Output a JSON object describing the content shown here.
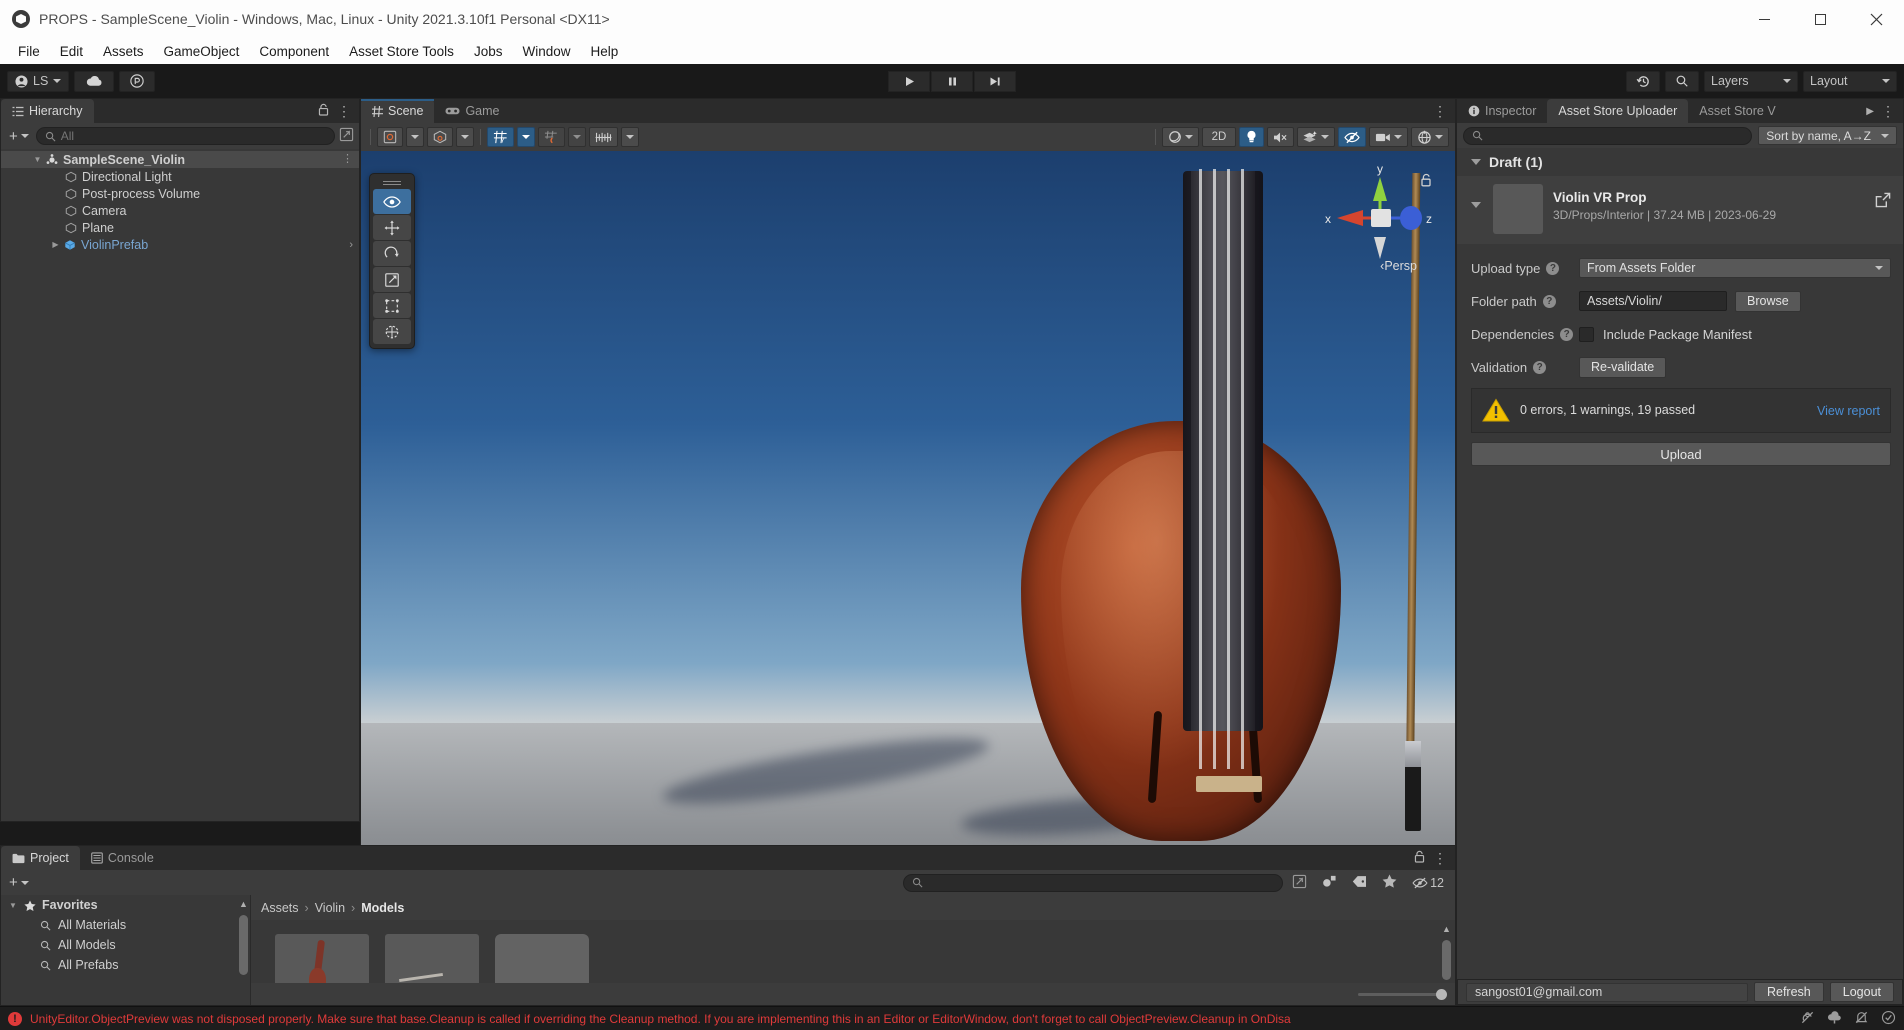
{
  "window": {
    "title": "PROPS - SampleScene_Violin - Windows, Mac, Linux - Unity 2021.3.10f1 Personal <DX11>",
    "minimize": "–",
    "maximize": "□",
    "close": "✕"
  },
  "menubar": {
    "items": [
      "File",
      "Edit",
      "Assets",
      "GameObject",
      "Component",
      "Asset Store Tools",
      "Jobs",
      "Window",
      "Help"
    ]
  },
  "toolbar": {
    "account_label": "LS",
    "cloud_tooltip": "cloud-icon",
    "collab_tooltip": "plastic-scm-icon",
    "play": "play-icon",
    "pause": "pause-icon",
    "step": "step-icon",
    "history": "history-icon",
    "search": "search-icon",
    "layers_label": "Layers",
    "layout_label": "Layout"
  },
  "hierarchy": {
    "tab_label": "Hierarchy",
    "lock_icon": "lock-icon",
    "menu_icon": "kebab-icon",
    "add_label": "+",
    "search_placeholder": "All",
    "items": [
      {
        "label": "SampleScene_Violin",
        "indent": 0,
        "icon": "scene-icon",
        "expanded": true,
        "selected": true,
        "kebab": true
      },
      {
        "label": "Directional Light",
        "indent": 1,
        "icon": "gameobject-icon"
      },
      {
        "label": "Post-process Volume",
        "indent": 1,
        "icon": "gameobject-icon"
      },
      {
        "label": "Camera",
        "indent": 1,
        "icon": "gameobject-icon"
      },
      {
        "label": "Plane",
        "indent": 1,
        "icon": "gameobject-icon"
      },
      {
        "label": "ViolinPrefab",
        "indent": 1,
        "icon": "prefab-icon",
        "prefab": true,
        "collapsed": true,
        "chevron": "›"
      }
    ]
  },
  "scene": {
    "tabs": [
      {
        "label": "Scene",
        "icon": "grid-icon",
        "active": true
      },
      {
        "label": "Game",
        "icon": "gamepad-icon",
        "active": false
      }
    ],
    "menu_icon": "kebab-icon",
    "toolbar_left": [
      {
        "name": "draw-mode-button",
        "icon": "pivot-icon",
        "has_caret": true
      },
      {
        "name": "pivot-rotation-button",
        "icon": "cube-icon",
        "has_caret": true
      },
      {
        "name": "grid-snap-button",
        "icon": "grid-snap-icon",
        "has_caret": true,
        "active": true
      },
      {
        "name": "grid-visibility-button",
        "icon": "magnet-grid-icon",
        "has_caret": true,
        "dim": true
      },
      {
        "name": "snap-increment-button",
        "icon": "ruler-icon",
        "has_caret": true
      }
    ],
    "toolbar_right": [
      {
        "name": "shading-mode-button",
        "icon": "sphere-icon",
        "has_caret": true
      },
      {
        "name": "2d-toggle-button",
        "label": "2D"
      },
      {
        "name": "scene-lighting-button",
        "icon": "bulb-icon",
        "active": true
      },
      {
        "name": "scene-audio-button",
        "icon": "mute-icon"
      },
      {
        "name": "fx-button",
        "icon": "fx-icon",
        "has_caret": true
      },
      {
        "name": "hidden-objects-button",
        "icon": "eye-off-icon",
        "active": true
      },
      {
        "name": "scene-camera-button",
        "icon": "camera-icon",
        "has_caret": true
      },
      {
        "name": "gizmos-button",
        "icon": "gizmo-icon",
        "has_caret": true
      }
    ],
    "tools_overlay": [
      {
        "name": "view-tool",
        "icon": "eye-icon",
        "active": true
      },
      {
        "name": "move-tool",
        "icon": "move-icon"
      },
      {
        "name": "rotate-tool",
        "icon": "rotate-icon"
      },
      {
        "name": "scale-tool",
        "icon": "scale-icon"
      },
      {
        "name": "rect-tool",
        "icon": "rect-icon"
      },
      {
        "name": "transform-tool",
        "icon": "transform-icon"
      }
    ],
    "gizmo": {
      "x_label": "x",
      "y_label": "y",
      "z_label": "z",
      "projection_label": "Persp",
      "lock_icon": "padlock-icon"
    }
  },
  "inspector": {
    "tabs": [
      {
        "label": "Inspector",
        "icon": "info-icon",
        "active": false
      },
      {
        "label": "Asset Store Uploader",
        "active": true
      },
      {
        "label": "Asset Store V",
        "truncated": true,
        "active": false
      }
    ],
    "overflow_icon": "chevron-right-icon",
    "menu_icon": "kebab-icon",
    "search_placeholder": "",
    "sort_label": "Sort by name, A→Z",
    "draft_header": "Draft (1)",
    "package": {
      "title": "Violin VR Prop",
      "meta": "3D/Props/Interior | 37.24 MB | 2023-06-29",
      "open_icon": "external-link-icon"
    },
    "fields": {
      "upload_type_label": "Upload type",
      "upload_type_value": "From Assets Folder",
      "folder_path_label": "Folder path",
      "folder_path_value": "Assets/Violin/",
      "browse_label": "Browse",
      "dependencies_label": "Dependencies",
      "include_manifest_label": "Include Package Manifest",
      "include_manifest_checked": false,
      "validation_label": "Validation",
      "revalidate_label": "Re-validate"
    },
    "validation": {
      "icon": "warning-icon",
      "text": "0 errors, 1 warnings, 19 passed",
      "view_report_label": "View report"
    },
    "upload_label": "Upload"
  },
  "project": {
    "tabs": [
      {
        "label": "Project",
        "icon": "folder-icon",
        "active": true
      },
      {
        "label": "Console",
        "icon": "console-icon",
        "active": false
      }
    ],
    "lock_icon": "lock-icon",
    "menu_icon": "kebab-icon",
    "add_label": "+",
    "tree": [
      {
        "label": "Favorites",
        "icon": "star-icon",
        "indent": 0,
        "expanded": true,
        "bold": true
      },
      {
        "label": "All Materials",
        "icon": "search-icon",
        "indent": 1
      },
      {
        "label": "All Models",
        "icon": "search-icon",
        "indent": 1
      },
      {
        "label": "All Prefabs",
        "icon": "search-icon",
        "indent": 1
      }
    ],
    "breadcrumb": [
      "Assets",
      "Violin",
      "Models"
    ],
    "search_placeholder": "",
    "filter_icons": [
      {
        "name": "expand-icon"
      },
      {
        "name": "type-filter-icon"
      },
      {
        "name": "label-filter-icon"
      },
      {
        "name": "favorite-filter-icon"
      }
    ],
    "hidden_count_label": "12",
    "hidden_count_icon": "eye-off-icon",
    "assets": [
      {
        "name": "violin-model-thumb"
      },
      {
        "name": "bow-model-thumb"
      },
      {
        "name": "asset-thumb-3"
      }
    ]
  },
  "account": {
    "email": "sangost01@gmail.com",
    "refresh_label": "Refresh",
    "logout_label": "Logout"
  },
  "statusbar": {
    "error_badge": "!",
    "message": "UnityEditor.ObjectPreview was not disposed properly. Make sure that base.Cleanup is called if overriding the Cleanup method. If you are implementing this in an Editor or EditorWindow, don't forget to call ObjectPreview.Cleanup in OnDisa",
    "icons": [
      {
        "name": "no-collab-icon"
      },
      {
        "name": "cloud-status-icon"
      },
      {
        "name": "no-notification-icon"
      },
      {
        "name": "check-status-icon"
      }
    ]
  }
}
